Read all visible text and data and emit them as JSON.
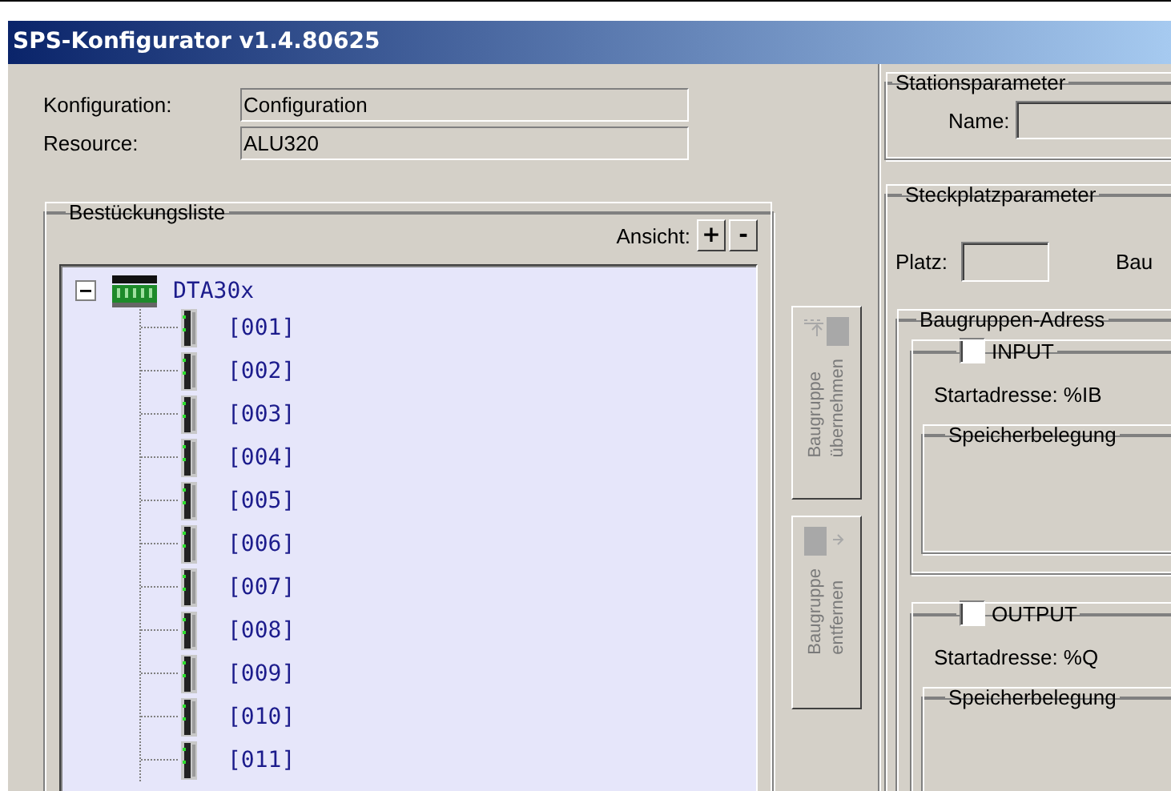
{
  "window": {
    "title": "SPS-Konfigurator v1.4.80625"
  },
  "info": [
    {
      "label": "Konfiguration:",
      "value": "Configuration"
    },
    {
      "label": "Resource:",
      "value": "ALU320"
    }
  ],
  "parts_list": {
    "title": "Bestückungsliste",
    "view_label": "Ansicht:",
    "view_buttons": [
      "+",
      "-"
    ],
    "tree": {
      "label": "DTA30x",
      "expanded": true,
      "children": [
        {
          "label": "[001]"
        },
        {
          "label": "[002]"
        },
        {
          "label": "[003]"
        },
        {
          "label": "[004]"
        },
        {
          "label": "[005]"
        },
        {
          "label": "[006]"
        },
        {
          "label": "[007]"
        },
        {
          "label": "[008]"
        },
        {
          "label": "[009]"
        },
        {
          "label": "[010]"
        },
        {
          "label": "[011]"
        }
      ]
    }
  },
  "side_buttons": [
    {
      "kind": "add",
      "lines": [
        "Baugruppe",
        "übernehmen"
      ],
      "disabled": true
    },
    {
      "kind": "remove",
      "lines": [
        "Baugruppe",
        "entfernen"
      ],
      "disabled": true
    }
  ],
  "station": {
    "title": "Stationsparameter",
    "name_label": "Name:"
  },
  "slot": {
    "title": "Steckplatzparameter",
    "platz_label": "Platz:",
    "column_2_label": "Bau",
    "address": {
      "title": "Baugruppen-Adress",
      "groups": [
        {
          "label": "INPUT",
          "checked": false,
          "start_label": "Startadresse: %IB",
          "memory_title": "Speicherbelegung"
        },
        {
          "label": "OUTPUT",
          "checked": false,
          "start_label": "Startadresse: %Q",
          "memory_title": "Speicherbelegung"
        }
      ]
    }
  }
}
